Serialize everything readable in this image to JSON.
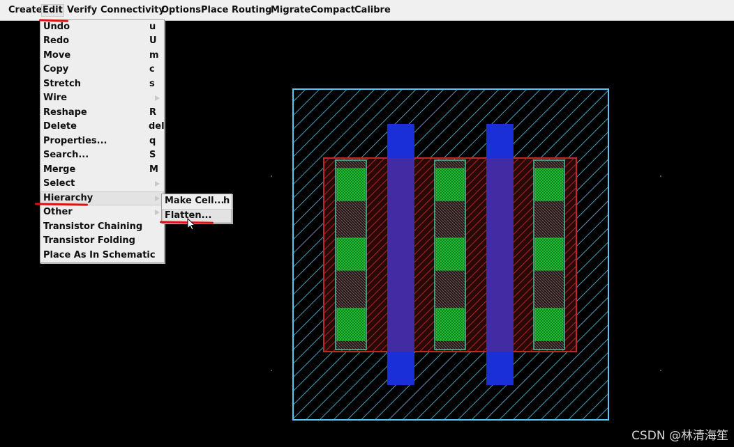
{
  "menubar": {
    "items": [
      {
        "label": "Create"
      },
      {
        "label": "Edit"
      },
      {
        "label": "Verify"
      },
      {
        "label": "Connectivity"
      },
      {
        "label": "Options"
      },
      {
        "label": "Place"
      },
      {
        "label": "Routing"
      },
      {
        "label": "Migrate"
      },
      {
        "label": "Compact"
      },
      {
        "label": "Calibre"
      }
    ]
  },
  "edit_menu": {
    "items": [
      {
        "label": "Undo",
        "shortcut": "u"
      },
      {
        "label": "Redo",
        "shortcut": "U"
      },
      {
        "label": "Move",
        "shortcut": "m"
      },
      {
        "label": "Copy",
        "shortcut": "c"
      },
      {
        "label": "Stretch",
        "shortcut": "s"
      },
      {
        "label": "Wire",
        "shortcut": ""
      },
      {
        "label": "Reshape",
        "shortcut": "R"
      },
      {
        "label": "Delete",
        "shortcut": "del"
      },
      {
        "label": "Properties...",
        "shortcut": "q"
      },
      {
        "label": "Search...",
        "shortcut": "S"
      },
      {
        "label": "Merge",
        "shortcut": "M"
      },
      {
        "label": "Select",
        "shortcut": ""
      },
      {
        "label": "Hierarchy",
        "shortcut": ""
      },
      {
        "label": "Other",
        "shortcut": ""
      },
      {
        "label": "Transistor Chaining",
        "shortcut": ""
      },
      {
        "label": "Transistor Folding",
        "shortcut": ""
      },
      {
        "label": "Place As In Schematic",
        "shortcut": ""
      }
    ]
  },
  "hierarchy_submenu": {
    "items": [
      {
        "label": "Make Cell...",
        "shortcut": "h"
      },
      {
        "label": "Flatten...",
        "shortcut": ""
      }
    ]
  },
  "colors": {
    "nwell": "#58c8f0",
    "diffusion": "#c02828",
    "poly": "#1a2fd8",
    "contact": "#20b830",
    "metal": "#40c8a0",
    "annotation": "#e01010"
  },
  "watermark": "CSDN @林清海笙"
}
